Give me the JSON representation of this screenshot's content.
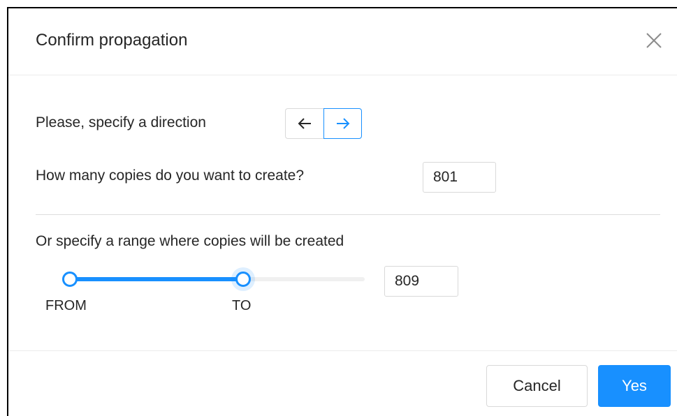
{
  "dialog": {
    "title": "Confirm propagation",
    "close_icon": "close-icon"
  },
  "direction": {
    "label": "Please, specify a direction",
    "left_icon": "arrow-left-icon",
    "right_icon": "arrow-right-icon",
    "selected": "right"
  },
  "copies": {
    "label": "How many copies do you want to create?",
    "value": "801"
  },
  "range": {
    "label": "Or specify a range where copies will be created",
    "from_label": "FROM",
    "to_label": "TO",
    "value": "809"
  },
  "footer": {
    "cancel_label": "Cancel",
    "yes_label": "Yes"
  },
  "colors": {
    "primary": "#1890ff",
    "border": "#d9d9d9",
    "text": "#262626"
  }
}
